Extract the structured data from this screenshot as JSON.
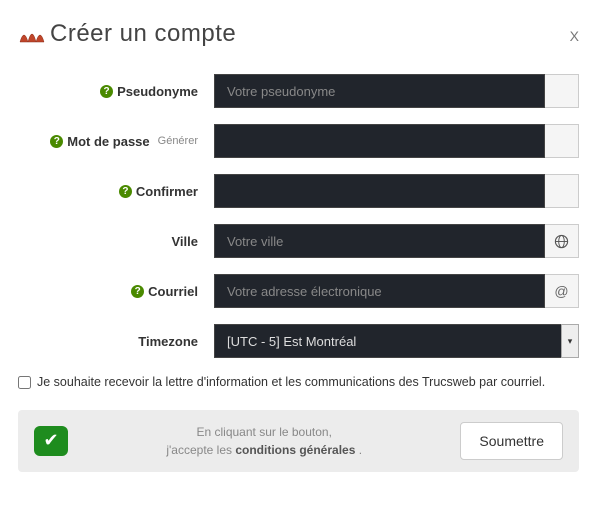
{
  "close": "X",
  "title": "Créer un compte",
  "fields": {
    "pseudonyme": {
      "label": "Pseudonyme",
      "placeholder": "Votre pseudonyme"
    },
    "password": {
      "label": "Mot de passe",
      "generate": "Générer"
    },
    "confirm": {
      "label": "Confirmer"
    },
    "ville": {
      "label": "Ville",
      "placeholder": "Votre ville"
    },
    "courriel": {
      "label": "Courriel",
      "placeholder": "Votre adresse électronique",
      "addon": "@"
    },
    "timezone": {
      "label": "Timezone",
      "value": "[UTC - 5] Est Montréal"
    }
  },
  "newsletter": "Je souhaite recevoir la lettre d'information et les communications des Trucsweb par courriel.",
  "footer": {
    "line1": "En cliquant sur le bouton,",
    "line2_prefix": "j'accepte les ",
    "terms": "conditions générales",
    "line2_suffix": " .",
    "submit": "Soumettre"
  },
  "help_glyph": "?"
}
